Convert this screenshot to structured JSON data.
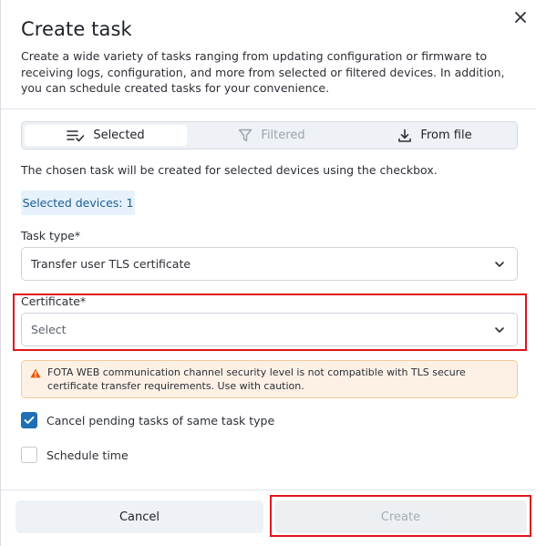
{
  "dialog": {
    "title": "Create task",
    "description": "Create a wide variety of tasks ranging from updating configuration or firmware to receiving logs, configuration, and more from selected or filtered devices. In addition, you can schedule created tasks for your convenience.",
    "close_icon": "close-icon"
  },
  "source_tabs": [
    {
      "label": "Selected",
      "icon": "selected-list-icon",
      "state": "active"
    },
    {
      "label": "Filtered",
      "icon": "filter-icon",
      "state": "disabled"
    },
    {
      "label": "From file",
      "icon": "download-icon",
      "state": "normal"
    }
  ],
  "info_text": "The chosen task will be created for selected devices using the checkbox.",
  "selected_badge": "Selected devices: 1",
  "task_type": {
    "label": "Task type*",
    "value": "Transfer user TLS certificate"
  },
  "certificate": {
    "label": "Certificate*",
    "placeholder": "Select"
  },
  "warning": {
    "icon": "warning-icon",
    "text": "FOTA WEB communication channel security level is not compatible with TLS secure certificate transfer requirements. Use with caution."
  },
  "options": {
    "cancel_pending": {
      "label": "Cancel pending tasks of same task type",
      "checked": true
    },
    "schedule_time": {
      "label": "Schedule time",
      "checked": false
    }
  },
  "footer": {
    "cancel_label": "Cancel",
    "create_label": "Create",
    "create_disabled": true
  },
  "colors": {
    "accent": "#1f6fb4",
    "highlight": "#e0141e",
    "warning_bg": "#fdf1e6",
    "warning_icon": "#e8590c",
    "badge_bg": "#e6f1fb"
  }
}
